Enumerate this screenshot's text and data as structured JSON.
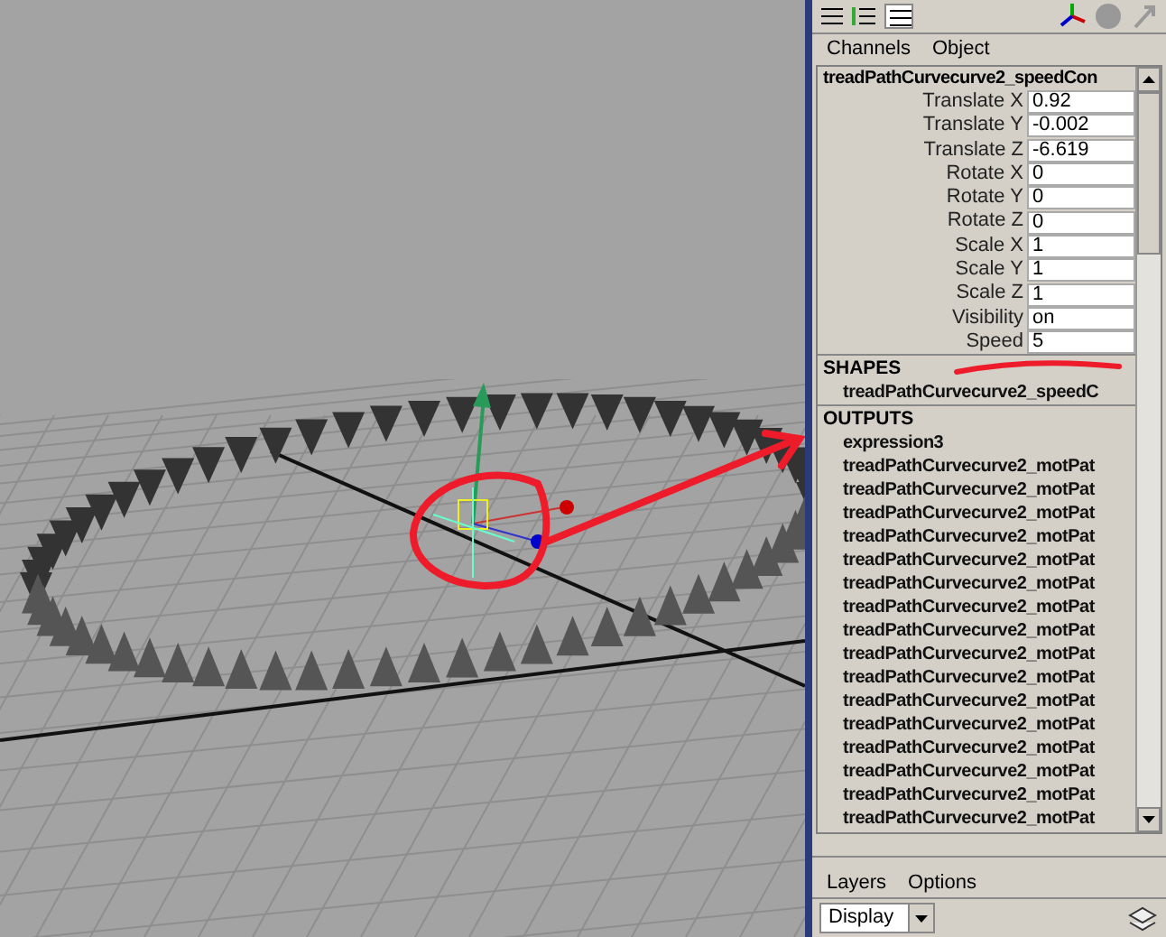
{
  "channel_box": {
    "menu": [
      "Channels",
      "Object"
    ],
    "node_name": "treadPathCurvecurve2_speedCon",
    "channels": [
      {
        "label": "Translate X",
        "value": "0.92"
      },
      {
        "label": "Translate Y",
        "value": "-0.002"
      },
      {
        "label": "Translate Z",
        "value": "-6.619"
      },
      {
        "label": "Rotate X",
        "value": "0"
      },
      {
        "label": "Rotate Y",
        "value": "0"
      },
      {
        "label": "Rotate Z",
        "value": "0"
      },
      {
        "label": "Scale X",
        "value": "1"
      },
      {
        "label": "Scale Y",
        "value": "1"
      },
      {
        "label": "Scale Z",
        "value": "1"
      },
      {
        "label": "Visibility",
        "value": "on"
      },
      {
        "label": "Speed",
        "value": "5"
      }
    ],
    "shapes": {
      "heading": "SHAPES",
      "items": [
        "treadPathCurvecurve2_speedC"
      ]
    },
    "outputs": {
      "heading": "OUTPUTS",
      "items": [
        "expression3",
        "treadPathCurvecurve2_motPat",
        "treadPathCurvecurve2_motPat",
        "treadPathCurvecurve2_motPat",
        "treadPathCurvecurve2_motPat",
        "treadPathCurvecurve2_motPat",
        "treadPathCurvecurve2_motPat",
        "treadPathCurvecurve2_motPat",
        "treadPathCurvecurve2_motPat",
        "treadPathCurvecurve2_motPat",
        "treadPathCurvecurve2_motPat",
        "treadPathCurvecurve2_motPat",
        "treadPathCurvecurve2_motPat",
        "treadPathCurvecurve2_motPat",
        "treadPathCurvecurve2_motPat",
        "treadPathCurvecurve2_motPat",
        "treadPathCurvecurve2_motPat"
      ]
    }
  },
  "layer_editor": {
    "menu": [
      "Layers",
      "Options"
    ],
    "display_dropdown": "Display"
  }
}
